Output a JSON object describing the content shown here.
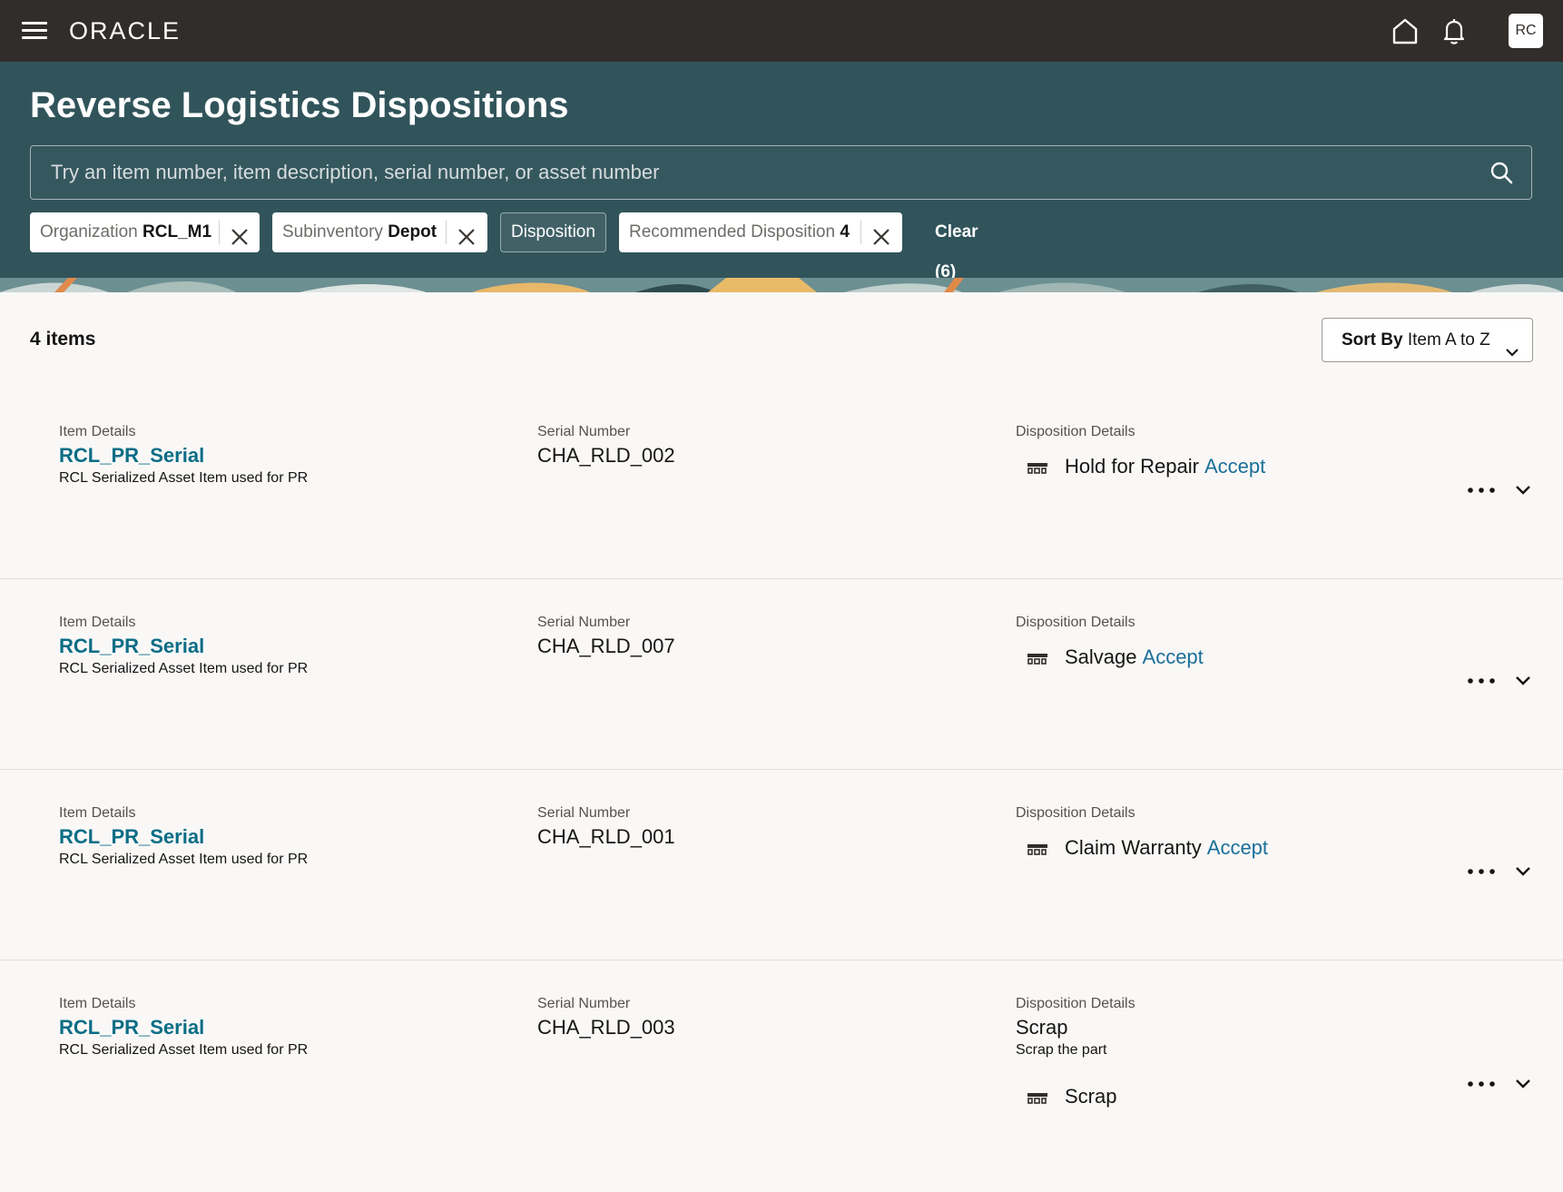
{
  "app": {
    "logo": "ORACLE",
    "avatar_initials": "RC"
  },
  "page": {
    "title": "Reverse Logistics Dispositions"
  },
  "search": {
    "placeholder": "Try an item number, item description, serial number, or asset number"
  },
  "filters": [
    {
      "key": "Organization",
      "value": "RCL_M1"
    },
    {
      "key": "Subinventory",
      "value": "Depot"
    },
    {
      "key": "Disposition",
      "value": ""
    },
    {
      "key": "Recommended Disposition",
      "value": "4"
    }
  ],
  "clear_label": "Clear (6)",
  "results": {
    "count_label": "4 items",
    "sort_key": "Sort By",
    "sort_value": "Item A to Z"
  },
  "labels": {
    "item_details": "Item Details",
    "serial_number": "Serial Number",
    "disposition_details": "Disposition Details"
  },
  "rows": [
    {
      "item": "RCL_PR_Serial",
      "description": "RCL Serialized Asset Item used for PR",
      "serial": "CHA_RLD_002",
      "disposition": "",
      "disposition_note": "",
      "recommendation": "Hold for Repair",
      "action": "Accept"
    },
    {
      "item": "RCL_PR_Serial",
      "description": "RCL Serialized Asset Item used for PR",
      "serial": "CHA_RLD_007",
      "disposition": "",
      "disposition_note": "",
      "recommendation": "Salvage",
      "action": "Accept"
    },
    {
      "item": "RCL_PR_Serial",
      "description": "RCL Serialized Asset Item used for PR",
      "serial": "CHA_RLD_001",
      "disposition": "",
      "disposition_note": "",
      "recommendation": "Claim Warranty",
      "action": "Accept"
    },
    {
      "item": "RCL_PR_Serial",
      "description": "RCL Serialized Asset Item used for PR",
      "serial": "CHA_RLD_003",
      "disposition": "Scrap",
      "disposition_note": "Scrap the part",
      "recommendation": "Scrap",
      "action": ""
    }
  ],
  "colors": {
    "topbar": "#312d2a",
    "header": "#31545b",
    "link": "#0a6d86",
    "accept": "#1b6f98"
  },
  "icons": [
    "menu-icon",
    "home-icon",
    "bell-icon",
    "search-icon",
    "close-icon",
    "chevron-down-icon",
    "more-icon",
    "disposition-icon"
  ]
}
